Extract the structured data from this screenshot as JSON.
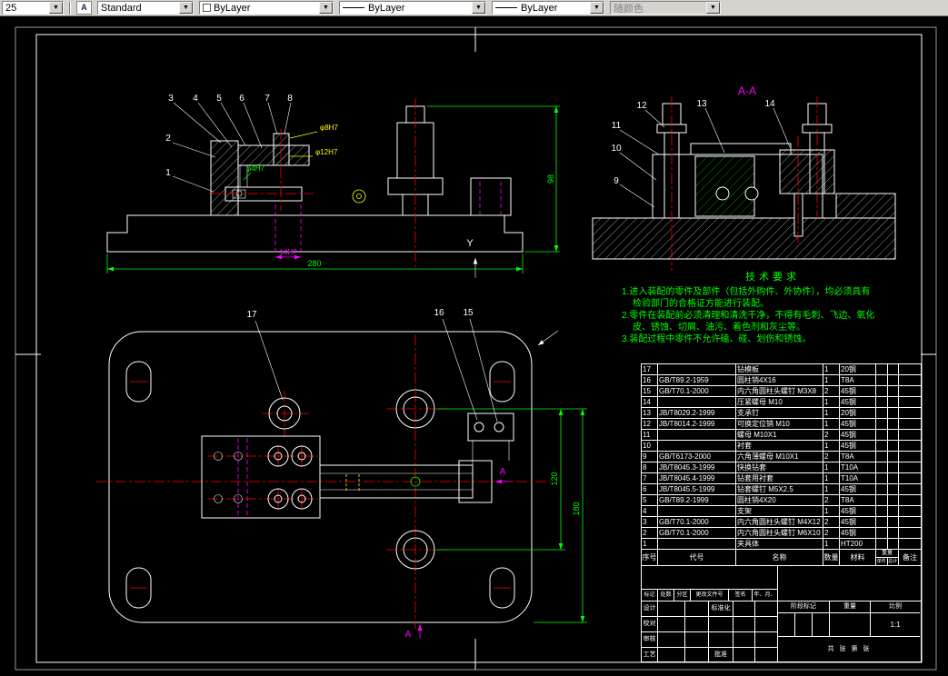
{
  "toolbar": {
    "partial_value": "25",
    "style_combo": "Standard",
    "style_icon_glyph": "A",
    "color_combo": "ByLayer",
    "linetype_combo": "ByLayer",
    "lineweight_combo": "ByLayer",
    "plotstyle_combo": "随颜色",
    "chevron": "▼"
  },
  "colors": {
    "dimension": "#00ff00",
    "centerline": "#ff0000",
    "auxiliary": "#ff00ff",
    "highlight": "#ffff00",
    "drawing": "#ffffff"
  },
  "drawing": {
    "callouts": [
      "1",
      "2",
      "3",
      "4",
      "5",
      "6",
      "7",
      "8",
      "9",
      "10",
      "11",
      "12",
      "13",
      "14",
      "15",
      "16",
      "17"
    ],
    "dims": {
      "width": "280",
      "height": "98",
      "plan_h": "120",
      "plan_total": "180",
      "bush_inner": "φ8H7",
      "bush_outer": "φ12H7",
      "pin": "φ4H7",
      "slot": "14H7"
    },
    "section_label": "A-A",
    "section_arrow": "A",
    "view_label_y": "Y"
  },
  "tech_req": {
    "title": "技术要求",
    "lines": [
      "1.进入装配的零件及部件（包括外购件、外协件），均必须具有",
      "检验部门的合格证方能进行装配。",
      "2.零件在装配前必须清理和清洗干净，不得有毛刺、飞边、氧化",
      "皮、锈蚀、切屑、油污、着色剂和灰尘等。",
      "3.装配过程中零件不允许磕、碰、划伤和锈蚀。"
    ]
  },
  "bom": {
    "headers": {
      "num": "序号",
      "code": "代号",
      "name": "名称",
      "qty": "数量",
      "material": "材料",
      "weight": "重量",
      "per": "单件",
      "total": "总计",
      "note": "备注"
    },
    "rows": [
      [
        "17",
        "",
        "钻模板",
        "1",
        "20钢",
        "",
        "",
        ""
      ],
      [
        "16",
        "GB/T89.2-1959",
        "圆柱销4X16",
        "1",
        "T8A",
        "",
        "",
        ""
      ],
      [
        "15",
        "GB/T70.1-2000",
        "内六角圆柱头螺钉 M3X8",
        "2",
        "45钢",
        "",
        "",
        ""
      ],
      [
        "14",
        "",
        "压紧螺母 M10",
        "1",
        "45钢",
        "",
        "",
        ""
      ],
      [
        "13",
        "JB/T8029.2-1999",
        "支承钉",
        "1",
        "20钢",
        "",
        "",
        ""
      ],
      [
        "12",
        "JB/T8014.2-1999",
        "可换定位销 M10",
        "1",
        "45钢",
        "",
        "",
        ""
      ],
      [
        "11",
        "",
        "螺母 M10X1",
        "2",
        "45钢",
        "",
        "",
        ""
      ],
      [
        "10",
        "",
        "衬套",
        "1",
        "45钢",
        "",
        "",
        ""
      ],
      [
        "9",
        "GB/T6173-2000",
        "六角薄螺母 M10X1",
        "2",
        "T8A",
        "",
        "",
        ""
      ],
      [
        "8",
        "JB/T8045.3-1999",
        "快换钻套",
        "1",
        "T10A",
        "",
        "",
        ""
      ],
      [
        "7",
        "JB/T8045.4-1999",
        "钻套用衬套",
        "1",
        "T10A",
        "",
        "",
        ""
      ],
      [
        "6",
        "JB/T8045.5-1999",
        "钻套螺钉 M5X2.5",
        "1",
        "45钢",
        "",
        "",
        ""
      ],
      [
        "5",
        "GB/T89.2-1999",
        "圆柱销4X20",
        "2",
        "T8A",
        "",
        "",
        ""
      ],
      [
        "4",
        "",
        "支架",
        "1",
        "45钢",
        "",
        "",
        ""
      ],
      [
        "3",
        "GB/T70.1-2000",
        "内六角圆柱头螺钉 M4X12",
        "2",
        "45钢",
        "",
        "",
        ""
      ],
      [
        "2",
        "GB/T70.1-2000",
        "内六角圆柱头螺钉 M6X10",
        "2",
        "45钢",
        "",
        "",
        ""
      ],
      [
        "1",
        "",
        "夹具体",
        "1",
        "HT200",
        "",
        "",
        ""
      ]
    ]
  },
  "title_block": {
    "rev_headers": [
      "标记",
      "处数",
      "分区",
      "更改文件号",
      "签名",
      "年、月、日"
    ],
    "sig_labels": [
      "设计",
      "校对",
      "审核",
      "工艺"
    ],
    "sig_labels2": [
      "标准化",
      "",
      "",
      "批准"
    ],
    "stage_label": "阶段标记",
    "weight_label": "重量",
    "scale_label": "比例",
    "scale_value": "1:1",
    "sheets_text": "共  张  第  张"
  }
}
